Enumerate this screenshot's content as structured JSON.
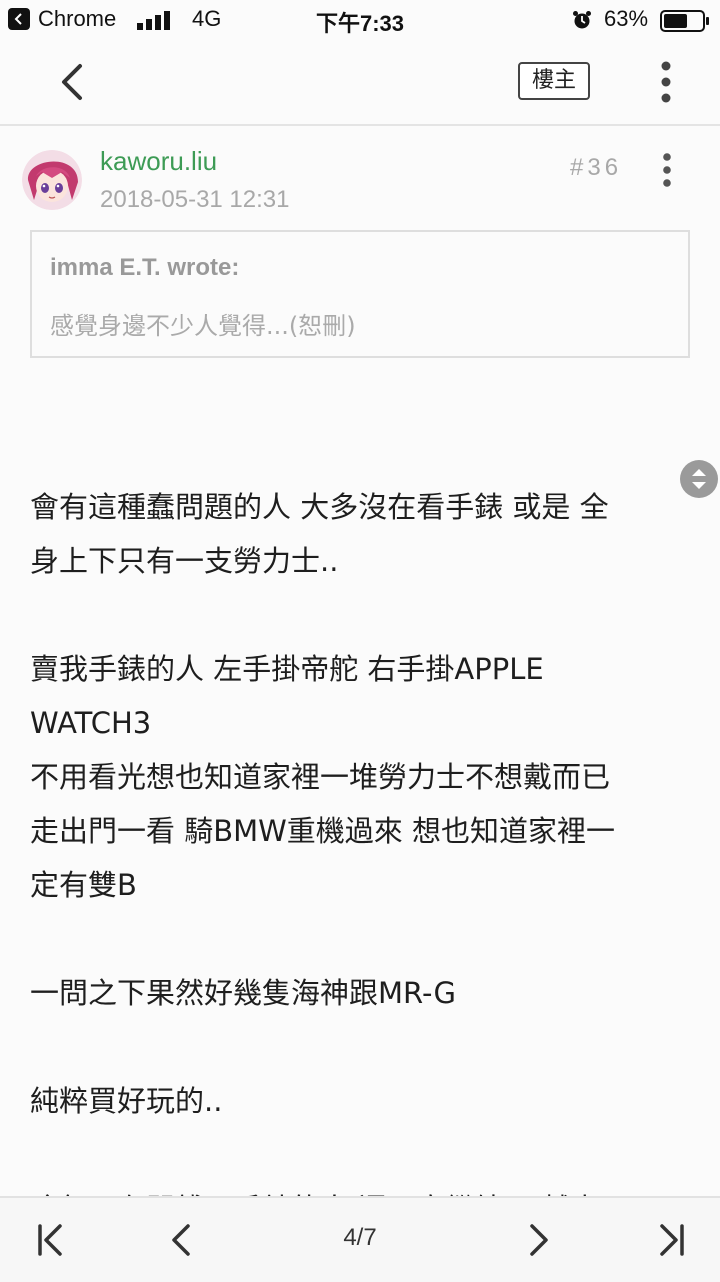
{
  "status_bar": {
    "back_app_label": "Chrome",
    "network": "4G",
    "time": "下午7:33",
    "battery_percent": "63%",
    "battery_level": 0.63
  },
  "nav": {
    "op_button_label": "樓主"
  },
  "post": {
    "username": "kaworu.liu",
    "date": "2018-05-31 12:31",
    "floor": "#36",
    "quote": {
      "author": "imma E.T. wrote:",
      "text": "感覺身邊不少人覺得...(恕刪)"
    },
    "body_lines": [
      "會有這種蠢問題的人 大多沒在看手錶 或是 全",
      "身上下只有一支勞力士..",
      "",
      "賣我手錶的人 左手掛帝舵 右手掛APPLE",
      "WATCH3",
      "不用看光想也知道家裡一堆勞力士不想戴而已",
      "走出門一看 騎BMW重機過來 想也知道家裡一",
      "定有雙B",
      "",
      "一問之下果然好幾隻海神跟MR-G",
      "",
      "純粹買好玩的..",
      "",
      "這年頭有閒錢玩手錶的人 還願意繼續玩 越來"
    ]
  },
  "pager": {
    "page_indicator": "4/7"
  }
}
